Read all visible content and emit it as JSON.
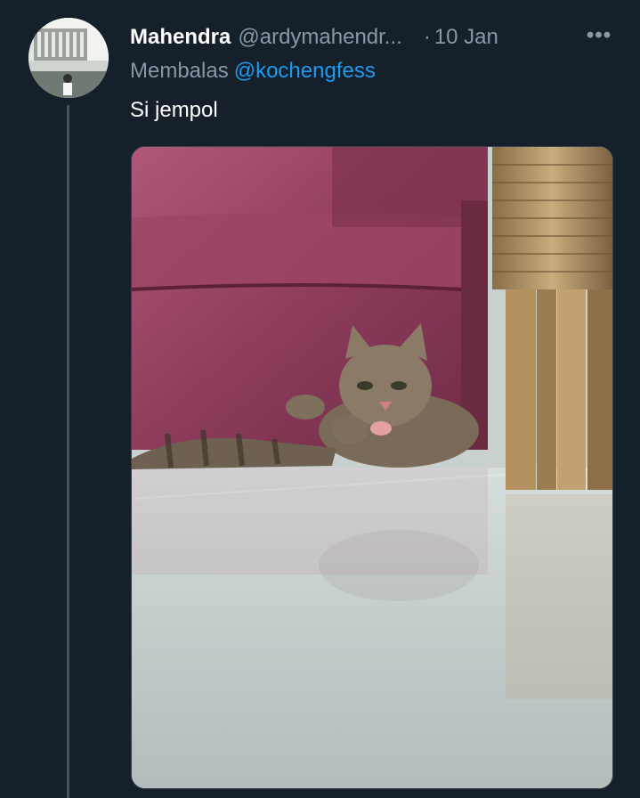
{
  "tweet": {
    "author_name": "Mahendra",
    "author_handle": "@ardymahendr...",
    "separator": "·",
    "date": "10 Jan",
    "more_label": "•••",
    "reply_prefix": "Membalas",
    "reply_to": "@kochengfess",
    "text": "Si jempol"
  },
  "colors": {
    "background": "#15202b",
    "secondary_text": "#8899a6",
    "link": "#1d9bf0"
  },
  "media": {
    "description_icon": "photo-of-kitten"
  }
}
